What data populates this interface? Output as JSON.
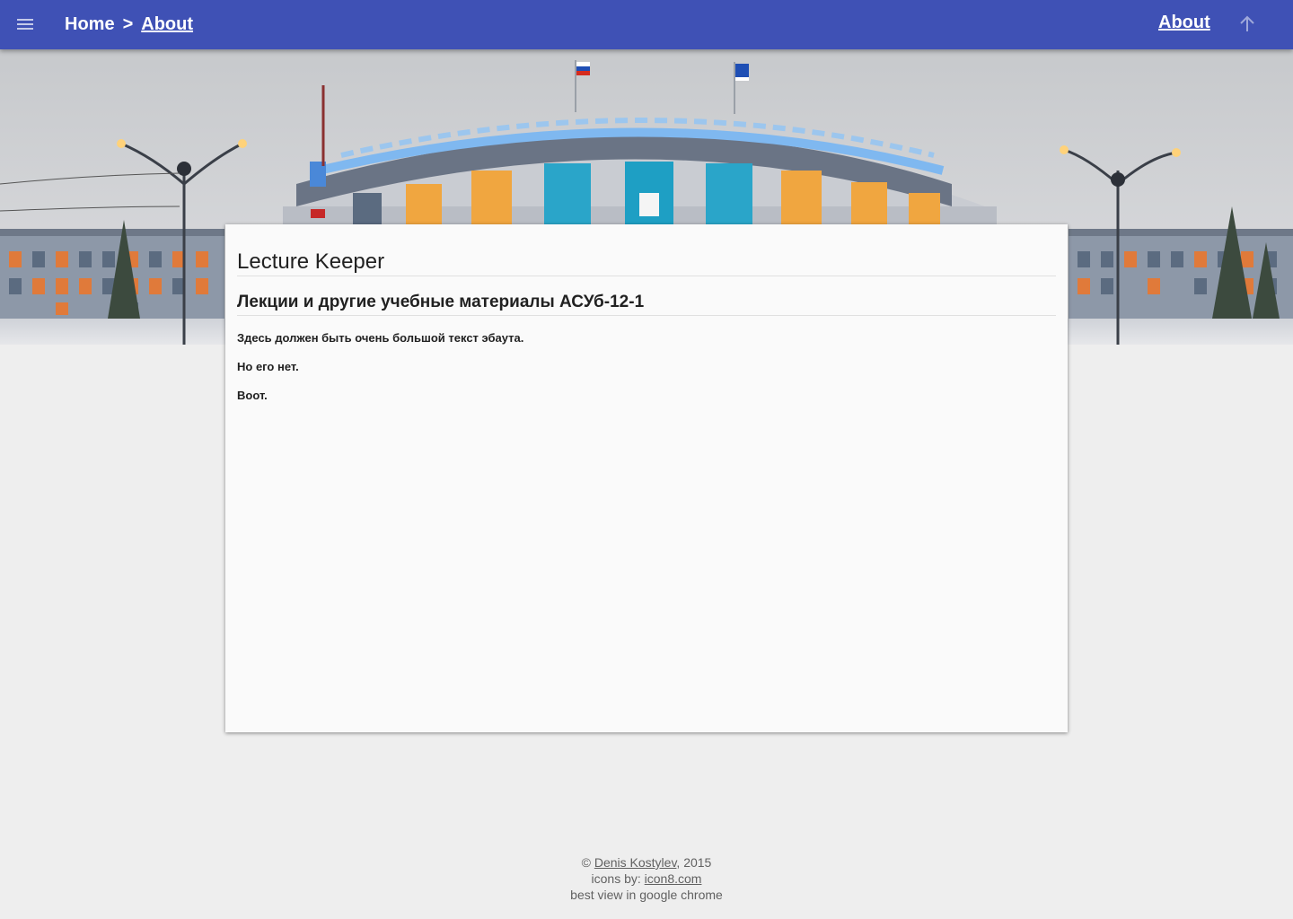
{
  "header": {
    "menu_icon": "hamburger-menu-icon",
    "breadcrumb": {
      "home_label": "Home",
      "separator": ">",
      "current_label": "About"
    },
    "nav_about_label": "About",
    "up_icon": "arrow-up-icon",
    "color": "#3f51b5"
  },
  "hero": {
    "description_icon": "university-building-photo"
  },
  "card": {
    "title": "Lecture Keeper",
    "subtitle": "Лекции и другие учебные материалы АСУб-12-1",
    "paragraphs": [
      "Здесь должен быть очень большой текст эбаута.",
      "Но его нет.",
      "Воот."
    ]
  },
  "footer": {
    "copyright_prefix": "© ",
    "author_link": "Denis Kostylev",
    "year_suffix": ", 2015",
    "icons_prefix": "icons by: ",
    "icons_link": "icon8.com",
    "best_view": "best view in google chrome"
  }
}
